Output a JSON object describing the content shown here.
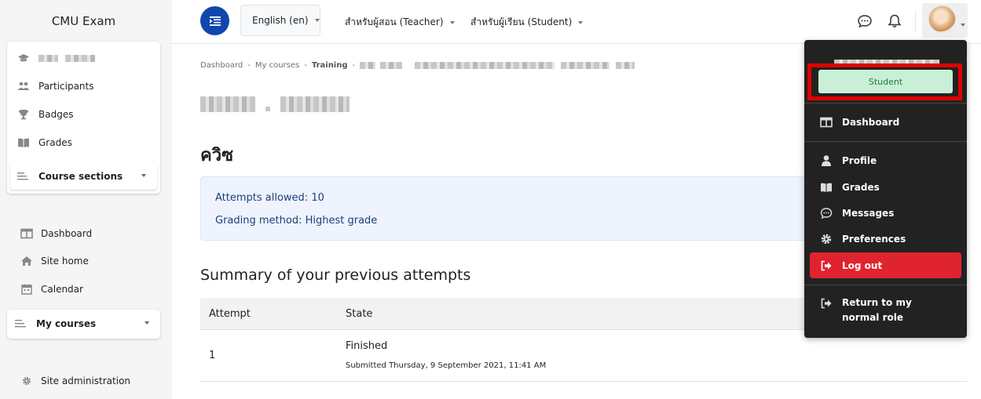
{
  "site": {
    "title": "CMU Exam"
  },
  "sidebar": {
    "course_nav": [
      {
        "label": "Participants",
        "icon": "users-icon"
      },
      {
        "label": "Badges",
        "icon": "trophy-icon"
      },
      {
        "label": "Grades",
        "icon": "grades-book-icon"
      }
    ],
    "course_sections_label": "Course sections",
    "site_nav": [
      {
        "label": "Dashboard",
        "icon": "dashboard-icon"
      },
      {
        "label": "Site home",
        "icon": "home-icon"
      },
      {
        "label": "Calendar",
        "icon": "calendar-icon"
      }
    ],
    "my_courses_label": "My courses",
    "site_admin_label": "Site administration"
  },
  "navbar": {
    "language": "English (en)",
    "teacher_menu": "สำหรับผู้สอน (Teacher)",
    "student_menu": "สำหรับผู้เรียน (Student)"
  },
  "breadcrumb": {
    "items": [
      "Dashboard",
      "My courses",
      "Training"
    ]
  },
  "quiz": {
    "title": "ควิซ",
    "attempts_allowed": "Attempts allowed: 10",
    "grading_method": "Grading method: Highest grade"
  },
  "summary": {
    "title": "Summary of your previous attempts",
    "headers": [
      "Attempt",
      "State"
    ],
    "rows": [
      {
        "attempt": "1",
        "state": "Finished",
        "submitted": "Submitted Thursday, 9 September 2021, 11:41 AM"
      }
    ]
  },
  "user_menu": {
    "role_badge": "Student",
    "items": [
      {
        "label": "Dashboard",
        "icon": "dashboard-icon"
      },
      {
        "label": "Profile",
        "icon": "user-icon"
      },
      {
        "label": "Grades",
        "icon": "grades-book-icon"
      },
      {
        "label": "Messages",
        "icon": "message-icon"
      },
      {
        "label": "Preferences",
        "icon": "gear-icon"
      }
    ],
    "logout": "Log out",
    "return_role": "Return to my normal role"
  },
  "colors": {
    "primary": "#0f47ad",
    "dropdown_bg": "#222222",
    "logout_red": "#e0242f",
    "highlight_red": "#e00000",
    "badge_green_bg": "#c9f0d7",
    "info_bg": "#eef3fd"
  }
}
